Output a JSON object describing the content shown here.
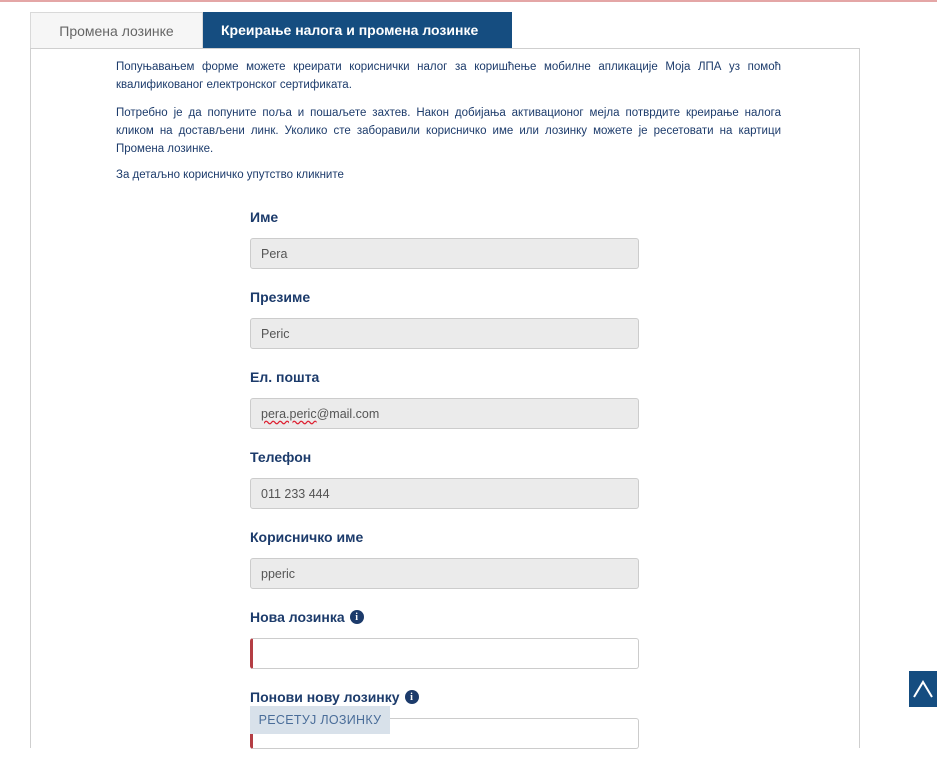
{
  "tabs": [
    {
      "label": "Промена лозинке",
      "active": false
    },
    {
      "label": "Креирање налога и промена лозинке",
      "active": true
    }
  ],
  "intro": {
    "p1": "Попуњавањем форме можете креирати кориснички налог за коришћење мобилне апликације Моја ЛПА уз помоћ квалификованог електронског сертификата.",
    "p2": "Потребно је да попуните поља и пошаљете захтев. Након добијања активационог мејла потврдите креирање налога кликом на достављени линк. Уколико сте заборавили корисничко име или лозинку можете је ресетовати на картици Промена лозинке.",
    "p3": "За детаљно корисничко упутство кликните"
  },
  "form": {
    "first_name": {
      "label": "Име",
      "value": "Pera"
    },
    "last_name": {
      "label": "Презиме",
      "value": "Peric"
    },
    "email": {
      "label": "Ел. пошта",
      "value_user": "pera.peric",
      "value_domain": "@mail.com"
    },
    "phone": {
      "label": "Телефон",
      "value": "011 233 444"
    },
    "username": {
      "label": "Корисничко име",
      "value": "pperic"
    },
    "new_password": {
      "label": "Нова лозинка",
      "value": ""
    },
    "repeat_password": {
      "label": "Понови нову лозинку",
      "value": ""
    }
  },
  "buttons": {
    "reset": "РЕСЕТУЈ ЛОЗИНКУ"
  },
  "icons": {
    "info": "info-circle-icon",
    "back_to_top": "chevron-up-icon"
  },
  "colors": {
    "accent": "#154d80",
    "invalid": "#b43e44",
    "text": "#1c3b6b"
  }
}
